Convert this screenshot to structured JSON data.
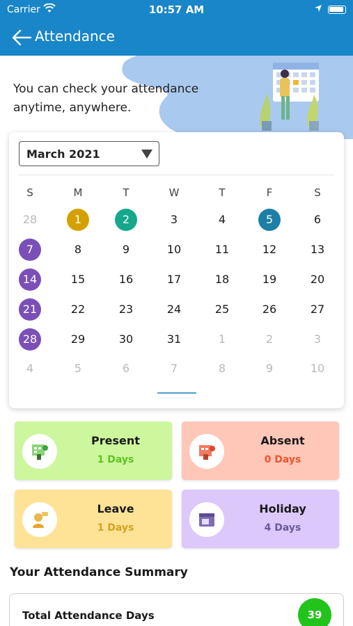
{
  "status_bar": {
    "carrier": "Carrier",
    "time": "10:57 AM"
  },
  "app_bar": {
    "title": "Attendance"
  },
  "intro_text": "You can check your attendance anytime, anywhere.",
  "calendar": {
    "month": "March 2021",
    "weekdays": [
      "S",
      "M",
      "T",
      "W",
      "T",
      "F",
      "S"
    ],
    "weeks": [
      [
        {
          "d": "28",
          "dim": true
        },
        {
          "d": "1",
          "mark": "present"
        },
        {
          "d": "2",
          "mark": "absent"
        },
        {
          "d": "3"
        },
        {
          "d": "4"
        },
        {
          "d": "5",
          "mark": "leave"
        },
        {
          "d": "6"
        }
      ],
      [
        {
          "d": "7",
          "mark": "holiday"
        },
        {
          "d": "8"
        },
        {
          "d": "9"
        },
        {
          "d": "10"
        },
        {
          "d": "11"
        },
        {
          "d": "12"
        },
        {
          "d": "13"
        }
      ],
      [
        {
          "d": "14",
          "mark": "holiday"
        },
        {
          "d": "15"
        },
        {
          "d": "16"
        },
        {
          "d": "17"
        },
        {
          "d": "18"
        },
        {
          "d": "19"
        },
        {
          "d": "20"
        }
      ],
      [
        {
          "d": "21",
          "mark": "holiday"
        },
        {
          "d": "22"
        },
        {
          "d": "23"
        },
        {
          "d": "24"
        },
        {
          "d": "25"
        },
        {
          "d": "26"
        },
        {
          "d": "27"
        }
      ],
      [
        {
          "d": "28",
          "mark": "holiday"
        },
        {
          "d": "29"
        },
        {
          "d": "30"
        },
        {
          "d": "31"
        },
        {
          "d": "1",
          "dim": true
        },
        {
          "d": "2",
          "dim": true
        },
        {
          "d": "3",
          "dim": true
        }
      ],
      [
        {
          "d": "4",
          "dim": true
        },
        {
          "d": "5",
          "dim": true
        },
        {
          "d": "6",
          "dim": true
        },
        {
          "d": "7",
          "dim": true
        },
        {
          "d": "8",
          "dim": true
        },
        {
          "d": "9",
          "dim": true
        },
        {
          "d": "10",
          "dim": true
        }
      ]
    ],
    "mark_colors": {
      "present": "#d4a000",
      "absent": "#14a98a",
      "leave": "#1e7fa6",
      "holiday": "#7a4fb8"
    }
  },
  "stats": [
    {
      "key": "present",
      "name": "Present",
      "count": "1 Days",
      "bg": "#ccf79d",
      "count_color": "#5cc41e",
      "icon": "present-icon"
    },
    {
      "key": "absent",
      "name": "Absent",
      "count": "0 Days",
      "bg": "#ffc7b8",
      "count_color": "#f0552c",
      "icon": "absent-icon"
    },
    {
      "key": "leave",
      "name": "Leave",
      "count": "1 Days",
      "bg": "#fee397",
      "count_color": "#d4a21e",
      "icon": "leave-icon"
    },
    {
      "key": "holiday",
      "name": "Holiday",
      "count": "4 Days",
      "bg": "#dcc8fb",
      "count_color": "#6a5a99",
      "icon": "holiday-icon"
    }
  ],
  "summary": {
    "title": "Your Attendance Summary",
    "total_label": "Total Attendance Days",
    "total_value": "39"
  },
  "colors": {
    "accent": "#1886c8"
  }
}
